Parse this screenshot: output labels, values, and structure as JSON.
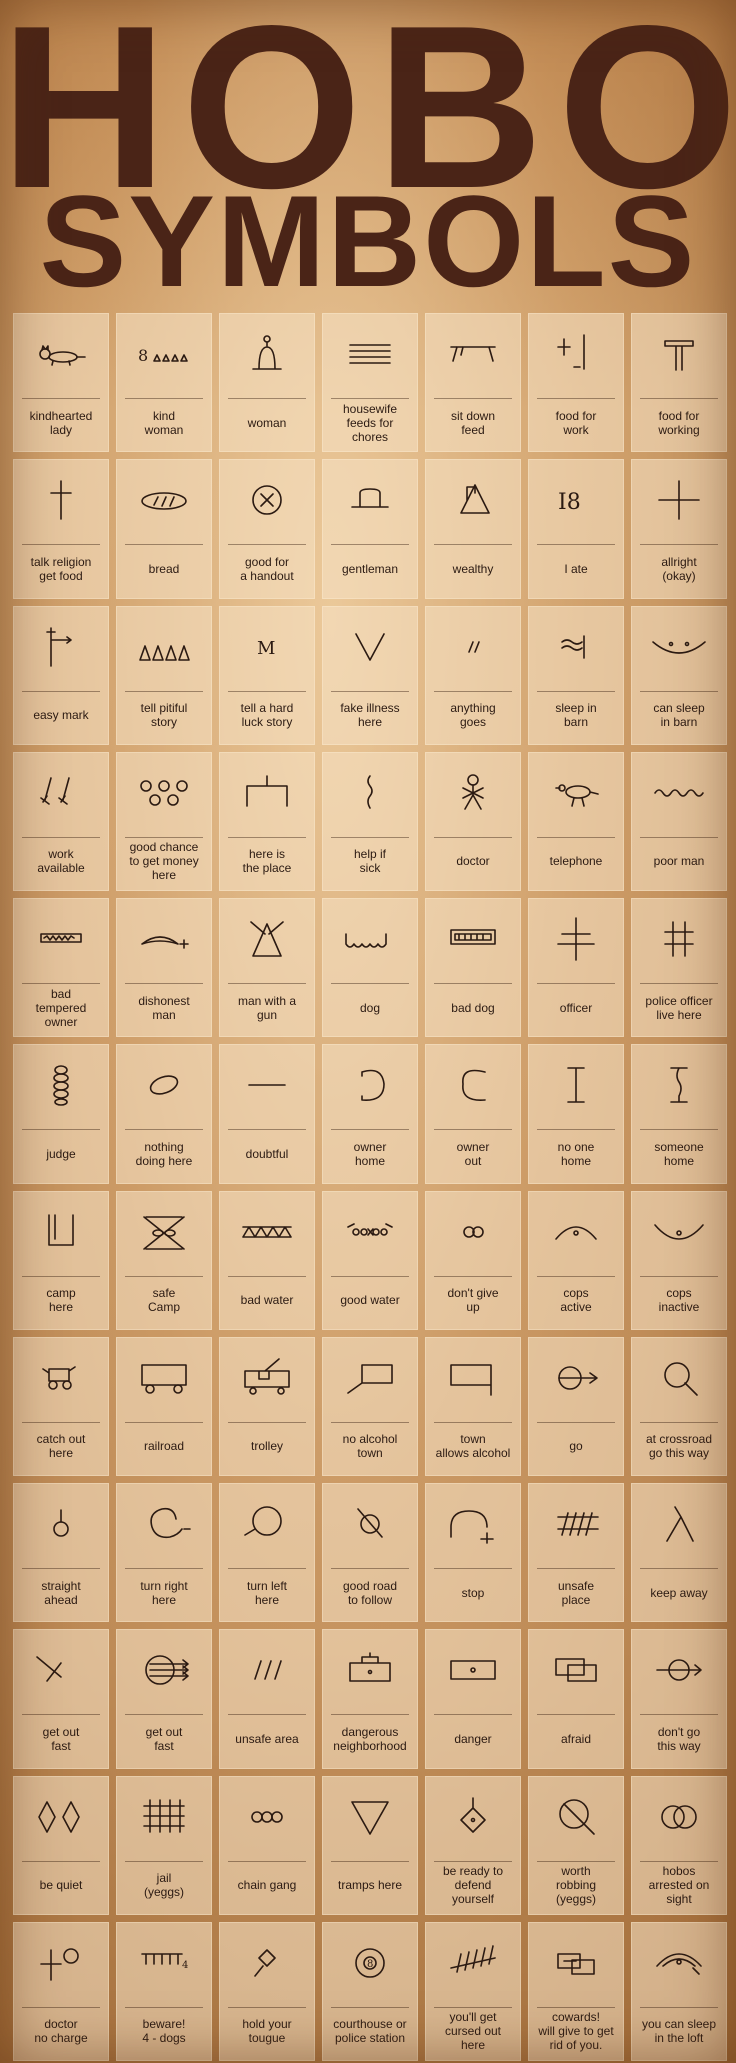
{
  "title": {
    "line1": "HOBO",
    "line2": "SYMBOLS"
  },
  "symbols": [
    {
      "label": "kindhearted\nlady",
      "icon": "cat-icon"
    },
    {
      "label": "kind\nwoman",
      "icon": "eight-triangles-icon"
    },
    {
      "label": "woman",
      "icon": "bell-woman-icon"
    },
    {
      "label": "housewife\nfeeds for\nchores",
      "icon": "stacked-lines-icon"
    },
    {
      "label": "sit down\nfeed",
      "icon": "table-icon"
    },
    {
      "label": "food for\nwork",
      "icon": "cross-and-line-icon"
    },
    {
      "label": "food for\nworking",
      "icon": "t-post-icon"
    },
    {
      "label": "talk religion\nget food",
      "icon": "cross-icon"
    },
    {
      "label": "bread",
      "icon": "bread-loaf-icon"
    },
    {
      "label": "good for\na handout",
      "icon": "circle-x-icon"
    },
    {
      "label": "gentleman",
      "icon": "top-hat-icon"
    },
    {
      "label": "wealthy",
      "icon": "triangle-flag-icon"
    },
    {
      "label": "I ate",
      "icon": "i8-icon"
    },
    {
      "label": "allright\n(okay)",
      "icon": "plus-icon"
    },
    {
      "label": "easy mark",
      "icon": "post-arrow-icon"
    },
    {
      "label": "tell pitiful\nstory",
      "icon": "four-triangles-icon"
    },
    {
      "label": "tell a hard\nluck story",
      "icon": "m-icon"
    },
    {
      "label": "fake illness\nhere",
      "icon": "v-icon"
    },
    {
      "label": "anything\ngoes",
      "icon": "double-slash-icon"
    },
    {
      "label": "sleep in\nbarn",
      "icon": "squiggle-lines-icon"
    },
    {
      "label": "can sleep\nin barn",
      "icon": "smile-curve-icon"
    },
    {
      "label": "work\navailable",
      "icon": "shovels-icon"
    },
    {
      "label": "good chance\nto get money\nhere",
      "icon": "five-circles-icon"
    },
    {
      "label": "here is\nthe place",
      "icon": "open-box-icon"
    },
    {
      "label": "help if\nsick",
      "icon": "squiggle-vertical-icon"
    },
    {
      "label": "doctor",
      "icon": "stick-figure-icon"
    },
    {
      "label": "telephone",
      "icon": "bird-icon"
    },
    {
      "label": "poor man",
      "icon": "wavy-line-icon"
    },
    {
      "label": "bad\ntempered\nowner",
      "icon": "zigzag-box-icon"
    },
    {
      "label": "dishonest\nman",
      "icon": "knife-icon"
    },
    {
      "label": "man with a\ngun",
      "icon": "triangle-crossed-icon"
    },
    {
      "label": "dog",
      "icon": "teeth-icon"
    },
    {
      "label": "bad dog",
      "icon": "bench-box-icon"
    },
    {
      "label": "officer",
      "icon": "double-cross-icon"
    },
    {
      "label": "police officer\nlive here",
      "icon": "hash-icon"
    },
    {
      "label": "judge",
      "icon": "coil-icon"
    },
    {
      "label": "nothing\ndoing here",
      "icon": "oval-icon"
    },
    {
      "label": "doubtful",
      "icon": "dash-icon"
    },
    {
      "label": "owner\nhome",
      "icon": "reverse-c-icon"
    },
    {
      "label": "owner\nout",
      "icon": "c-shape-icon"
    },
    {
      "label": "no one\nhome",
      "icon": "i-beam-icon"
    },
    {
      "label": "someone\nhome",
      "icon": "i-beam-curved-icon"
    },
    {
      "label": "camp\nhere",
      "icon": "u-box-icon"
    },
    {
      "label": "safe\nCamp",
      "icon": "crossed-box-icon"
    },
    {
      "label": "bad water",
      "icon": "zigzag-rows-icon"
    },
    {
      "label": "good water",
      "icon": "beads-icon"
    },
    {
      "label": "don't give\nup",
      "icon": "linked-rings-icon"
    },
    {
      "label": "cops\nactive",
      "icon": "arc-dot-icon"
    },
    {
      "label": "cops\ninactive",
      "icon": "cup-dot-icon"
    },
    {
      "label": "catch out\nhere",
      "icon": "cart-icon"
    },
    {
      "label": "railroad",
      "icon": "wagon-icon"
    },
    {
      "label": "trolley",
      "icon": "trolley-icon"
    },
    {
      "label": "no alcohol\ntown",
      "icon": "box-slash-icon"
    },
    {
      "label": "town\nallows alcohol",
      "icon": "box-tail-icon"
    },
    {
      "label": "go",
      "icon": "circle-arrow-icon"
    },
    {
      "label": "at crossroad\ngo this way",
      "icon": "circle-tail-icon"
    },
    {
      "label": "straight\nahead",
      "icon": "circle-stem-icon"
    },
    {
      "label": "turn right\nhere",
      "icon": "ring-right-icon"
    },
    {
      "label": "turn left\nhere",
      "icon": "ring-left-icon"
    },
    {
      "label": "good road\nto follow",
      "icon": "slashed-circle-icon"
    },
    {
      "label": "stop",
      "icon": "arch-plus-icon"
    },
    {
      "label": "unsafe\nplace",
      "icon": "fence-hash-icon"
    },
    {
      "label": "keep away",
      "icon": "lambda-icon"
    },
    {
      "label": "get out\nfast",
      "icon": "angle-icon"
    },
    {
      "label": "get out\nfast",
      "icon": "circle-arrows-icon"
    },
    {
      "label": "unsafe area",
      "icon": "triple-slash-icon"
    },
    {
      "label": "dangerous\nneighborhood",
      "icon": "boxed-dot-icon"
    },
    {
      "label": "danger",
      "icon": "box-dot-icon"
    },
    {
      "label": "afraid",
      "icon": "overlap-boxes-icon"
    },
    {
      "label": "don't go\nthis way",
      "icon": "circle-cross-arrow-icon"
    },
    {
      "label": "be quiet",
      "icon": "two-diamonds-icon"
    },
    {
      "label": "jail\n(yeggs)",
      "icon": "bars-grid-icon"
    },
    {
      "label": "chain gang",
      "icon": "three-rings-icon"
    },
    {
      "label": "tramps here",
      "icon": "down-triangle-icon"
    },
    {
      "label": "be ready to\ndefend\nyourself",
      "icon": "diamond-stem-icon"
    },
    {
      "label": "worth\nrobbing\n(yeggs)",
      "icon": "circle-slash-icon"
    },
    {
      "label": "hobos\narrested on\nsight",
      "icon": "handcuff-rings-icon"
    },
    {
      "label": "doctor\nno charge",
      "icon": "cross-circle-icon"
    },
    {
      "label": "beware!\n4 - dogs",
      "icon": "comb-icon"
    },
    {
      "label": "hold your\ntougue",
      "icon": "small-diamond-icon"
    },
    {
      "label": "courthouse or\npolice station",
      "icon": "target-icon"
    },
    {
      "label": "you'll get\ncursed out\nhere",
      "icon": "tally-icon"
    },
    {
      "label": "cowards!\nwill give to get\nrid of you.",
      "icon": "linked-boxes-icon"
    },
    {
      "label": "you can sleep\nin the loft",
      "icon": "eye-arc-icon"
    }
  ]
}
